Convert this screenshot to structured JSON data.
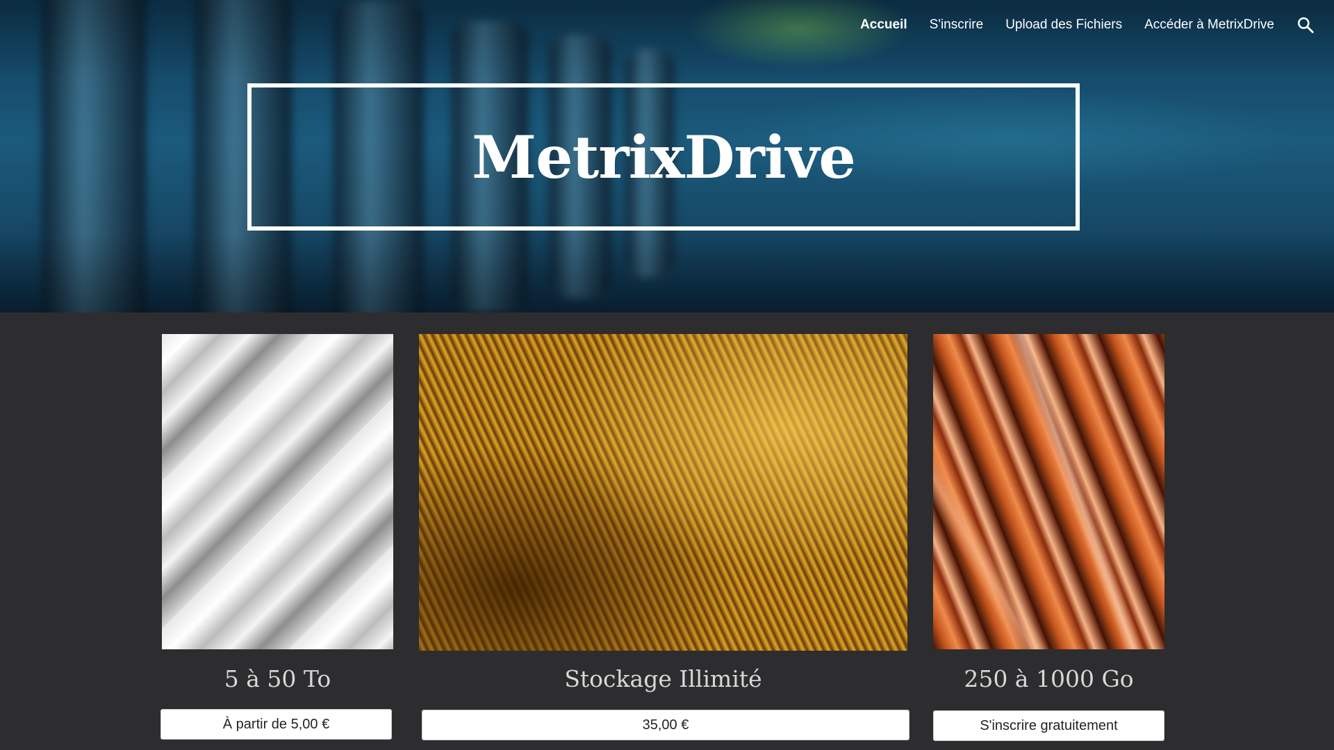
{
  "nav": {
    "items": [
      {
        "label": "Accueil",
        "active": true
      },
      {
        "label": "S'inscrire",
        "active": false
      },
      {
        "label": "Upload des Fichiers",
        "active": false
      },
      {
        "label": "Accéder à MetrixDrive",
        "active": false
      }
    ],
    "search_icon": "search-icon"
  },
  "hero": {
    "title": "MetrixDrive"
  },
  "cards": [
    {
      "title": "5 à 50 To",
      "button": "À partir de 5,00 €",
      "image": "silver-stripes"
    },
    {
      "title": "Stockage Illimité",
      "button": "35,00 €",
      "image": "gold-waves"
    },
    {
      "title": "250 à 1000 Go",
      "button": "S'inscrire gratuitement",
      "image": "copper-shards"
    }
  ],
  "colors": {
    "page_background": "#2d2d2f",
    "hero_blue": "#1b5a7c",
    "text_light": "#d8d8d8"
  }
}
